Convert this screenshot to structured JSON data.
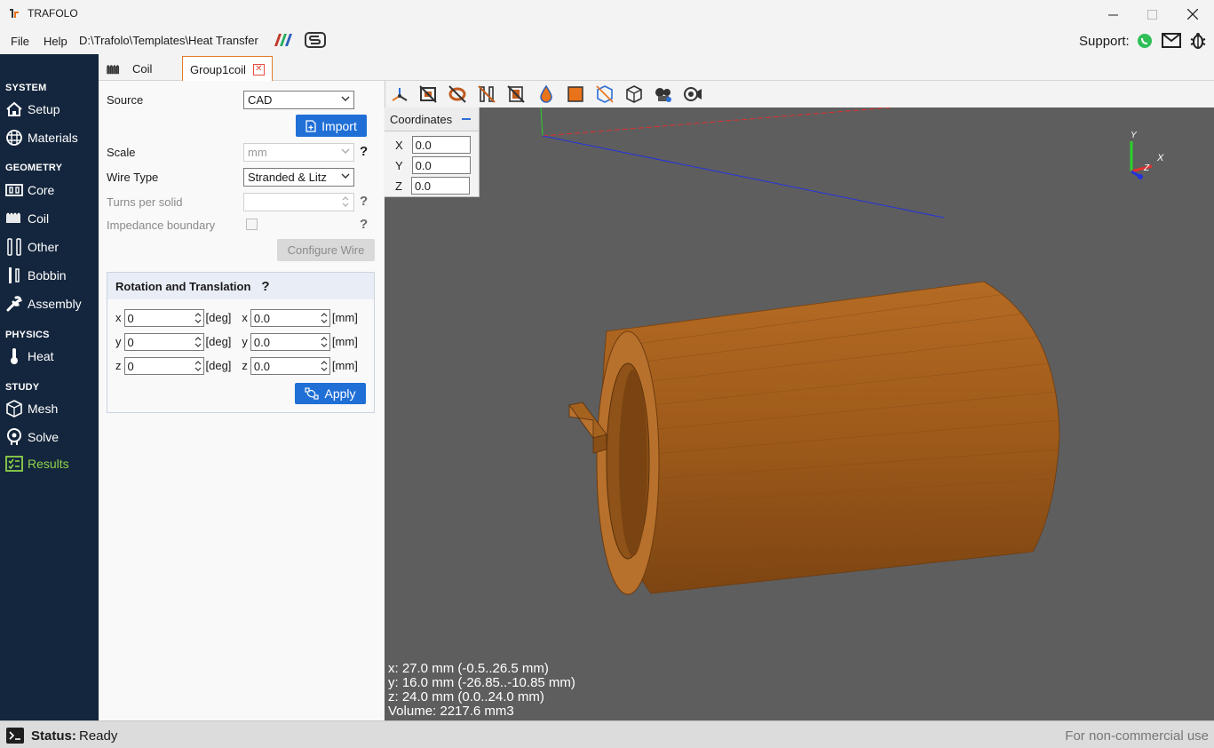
{
  "app": {
    "title": "TRAFOLO",
    "path": "D:\\Trafolo\\Templates\\Heat Transfer",
    "support_label": "Support:"
  },
  "menu": {
    "file": "File",
    "help": "Help"
  },
  "sidebar": {
    "system_head": "SYSTEM",
    "setup": "Setup",
    "materials": "Materials",
    "geometry_head": "GEOMETRY",
    "core": "Core",
    "coil": "Coil",
    "other": "Other",
    "bobbin": "Bobbin",
    "assembly": "Assembly",
    "physics_head": "PHYSICS",
    "heat": "Heat",
    "study_head": "STUDY",
    "mesh": "Mesh",
    "solve": "Solve",
    "results": "Results",
    "active_color": "#8ed34a"
  },
  "tabs": {
    "coil": "Coil",
    "group": "Group1coil"
  },
  "form": {
    "source_label": "Source",
    "source_value": "CAD",
    "import_label": "Import",
    "scale_label": "Scale",
    "scale_value": "mm",
    "wire_type_label": "Wire Type",
    "wire_type_value": "Stranded & Litz",
    "turns_label": "Turns per solid",
    "turns_value": "",
    "impedance_label": "Impedance boundary",
    "configure_wire_label": "Configure Wire",
    "help_mark": "?"
  },
  "rotation": {
    "title": "Rotation and Translation",
    "help_mark": "?",
    "rows": [
      {
        "rot_axis": "x",
        "rot_value": "0",
        "rot_unit": "[deg]",
        "tr_axis": "x",
        "tr_value": "0.0",
        "tr_unit": "[mm]"
      },
      {
        "rot_axis": "y",
        "rot_value": "0",
        "rot_unit": "[deg]",
        "tr_axis": "y",
        "tr_value": "0.0",
        "tr_unit": "[mm]"
      },
      {
        "rot_axis": "z",
        "rot_value": "0",
        "rot_unit": "[deg]",
        "tr_axis": "z",
        "tr_value": "0.0",
        "tr_unit": "[mm]"
      }
    ],
    "apply_label": "Apply"
  },
  "coordinates": {
    "title": "Coordinates",
    "x_label": "X",
    "x_value": "0.0",
    "y_label": "Y",
    "y_value": "0.0",
    "z_label": "Z",
    "z_value": "0.0"
  },
  "triad": {
    "x": "X",
    "y": "Y",
    "z": "Z"
  },
  "dimensions": {
    "x": "x: 27.0 mm (-0.5..26.5 mm)",
    "y": "y: 16.0 mm (-26.85..-10.85 mm)",
    "z": "z: 24.0 mm (0.0..24.0 mm)",
    "volume": "Volume: 2217.6 mm3"
  },
  "status": {
    "label": "Status:",
    "value": "Ready",
    "license": "For non-commercial use"
  },
  "colors": {
    "sidebar_bg": "#14263d",
    "accent_blue": "#1f6fd6",
    "viewport_bg": "#5e5e5e",
    "coil_copper": "#a8621f"
  }
}
